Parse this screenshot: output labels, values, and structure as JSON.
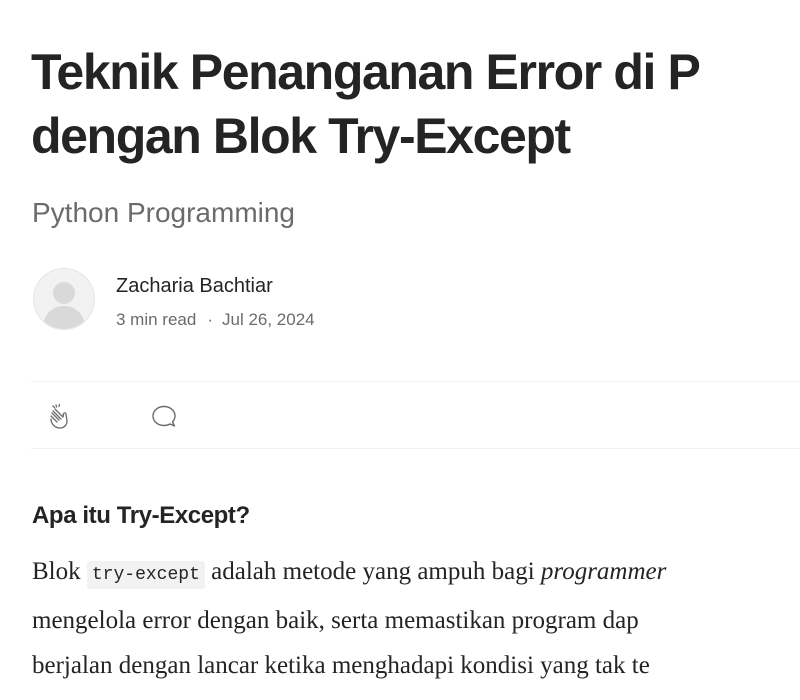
{
  "article": {
    "title_line1": "Teknik Penanganan Error di P",
    "title_line2": "dengan Blok Try-Except",
    "subtitle": "Python Programming",
    "author": {
      "name": "Zacharia Bachtiar",
      "read_time": "3 min read",
      "separator": "·",
      "date": "Jul 26, 2024",
      "avatar_icon": "default-user-avatar"
    },
    "actions": {
      "clap_icon": "clap-icon",
      "comment_icon": "comment-icon"
    },
    "section": {
      "heading": "Apa itu Try-Except?",
      "line1_prefix": "Blok ",
      "line1_code": "try-except",
      "line1_mid": " adalah metode yang ampuh bagi ",
      "line1_em": "programmer",
      "line2": "mengelola error dengan baik, serta memastikan program dap",
      "line3": "berjalan dengan lancar ketika menghadapi kondisi yang tak te"
    }
  },
  "colors": {
    "text_primary": "#242424",
    "text_secondary": "#6b6b6b",
    "divider": "#f2f2f2",
    "code_background": "#f2f2f2"
  }
}
